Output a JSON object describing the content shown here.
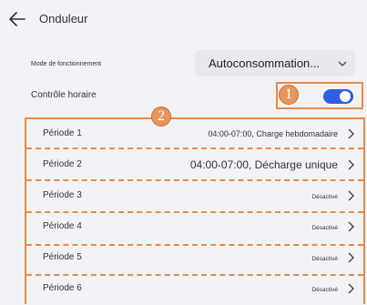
{
  "header": {
    "title": "Onduleur"
  },
  "mode": {
    "label": "Mode de fonctionnement",
    "value": "Autoconsommation..."
  },
  "controle": {
    "label": "Contrôle horaire",
    "enabled": true
  },
  "annotations": [
    "1",
    "2"
  ],
  "periods": [
    {
      "name": "Période 1",
      "value": "04:00-07:00, Charge hebdomadaire"
    },
    {
      "name": "Période 2",
      "value": "04:00-07:00, Décharge unique"
    },
    {
      "name": "Période 3",
      "value": "Désactivé"
    },
    {
      "name": "Période 4",
      "value": "Désactivé"
    },
    {
      "name": "Période 5",
      "value": "Désactivé"
    },
    {
      "name": "Période 6",
      "value": "Désactivé"
    }
  ],
  "colors": {
    "accent": "#2f5fdd",
    "annotation": "#e88a4a",
    "background": "#f2f3f7"
  }
}
